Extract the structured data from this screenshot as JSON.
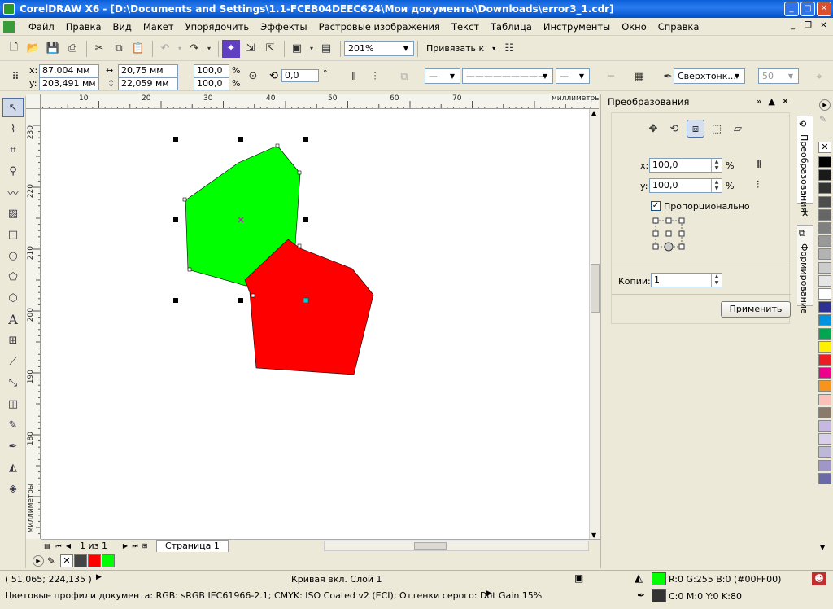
{
  "window": {
    "title": "CorelDRAW X6 - [D:\\Documents and Settings\\1.1-FCEB04DEEC624\\Мои документы\\Downloads\\error3_1.cdr]"
  },
  "menu": [
    "Файл",
    "Правка",
    "Вид",
    "Макет",
    "Упорядочить",
    "Эффекты",
    "Растровые изображения",
    "Текст",
    "Таблица",
    "Инструменты",
    "Окно",
    "Справка"
  ],
  "toolbar": {
    "zoom": "201%",
    "snap": "Привязать к"
  },
  "property_bar": {
    "x_label": "x:",
    "x": "87,004 мм",
    "y_label": "y:",
    "y": "203,491 мм",
    "width": "20,75 мм",
    "height": "22,059 мм",
    "scale_x": "100,0",
    "scale_y": "100,0",
    "percent": "%",
    "rotation": "0,0",
    "degree": "°",
    "outline": "Сверхтонк...",
    "value_50": "50"
  },
  "rulers": {
    "unit": "миллиметры",
    "top_ticks": [
      "10",
      "20",
      "30",
      "40",
      "50",
      "60",
      "70"
    ],
    "left_ticks": [
      "230",
      "220",
      "210",
      "200",
      "190",
      "180"
    ]
  },
  "page_nav": {
    "count": "1 из 1",
    "tab": "Страница 1"
  },
  "docker": {
    "title": "Преобразования",
    "x_label": "x:",
    "x_value": "100,0",
    "y_label": "y:",
    "y_value": "100,0",
    "percent": "%",
    "proportional": "Пропорционально",
    "copies_label": "Копии:",
    "copies_value": "1",
    "apply": "Применить"
  },
  "vertical_tabs": {
    "transform": "Преобразования",
    "shaping": "Формирование"
  },
  "status": {
    "coords": "( 51,065; 224,135 )",
    "object": "Кривая вкл. Слой 1",
    "fill": "R:0 G:255 B:0 (#00FF00)",
    "outline": "C:0 M:0 Y:0 K:80",
    "profiles": "Цветовые профили документа: RGB: sRGB IEC61966-2.1; CMYK: ISO Coated v2 (ECI); Оттенки серого: Dot Gain 15%"
  },
  "colors": {
    "green": "#00ff00",
    "red": "#ff0000",
    "selection_handle": "#000000",
    "fill_swatch": "#00ff00",
    "outline_swatch": "#333333"
  },
  "palette": [
    "#000000",
    "#1a1a1a",
    "#333333",
    "#4d4d4d",
    "#666666",
    "#808080",
    "#999999",
    "#b3b3b3",
    "#cccccc",
    "#e6e6e6",
    "#ffffff",
    "#2e3192",
    "#0093dd",
    "#00a651",
    "#ffef00",
    "#ed1c24",
    "#ec008c",
    "#f7941d",
    "#fbc1b8",
    "#8b7a6b",
    "#c6b8e0",
    "#d8d0ea",
    "#bdb7d8",
    "#9e97c8",
    "#6b6aa8"
  ]
}
